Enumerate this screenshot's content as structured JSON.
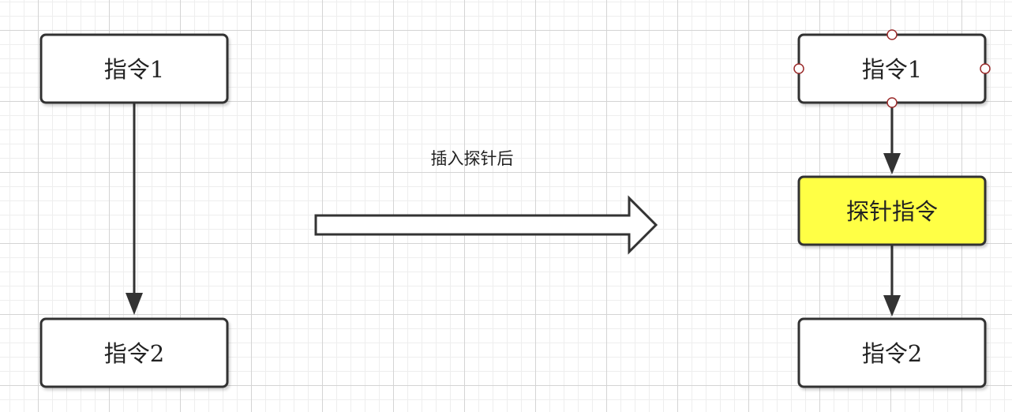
{
  "diagram": {
    "before": {
      "instruction_1": "指令1",
      "instruction_2": "指令2"
    },
    "transition": {
      "caption": "插入探针后"
    },
    "after": {
      "instruction_1": "指令1",
      "probe_instruction": "探针指令",
      "instruction_2": "指令2"
    }
  },
  "colors": {
    "node_fill": "#ffffff",
    "node_stroke": "#333333",
    "probe_fill": "#ffff44",
    "edge": "#333333",
    "handle_stroke": "#9b2b2b"
  }
}
